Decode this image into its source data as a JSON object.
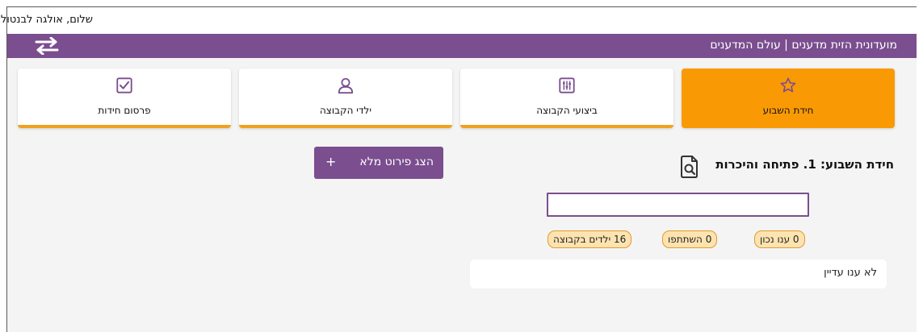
{
  "header": {
    "greeting": "שלום, אולגה לבנטול",
    "title": "מועדונית הזית מדענים | עולם המדענים"
  },
  "tabs": [
    {
      "label": "חידת השבוע",
      "icon": "star-icon",
      "active": true
    },
    {
      "label": "ביצועי הקבוצה",
      "icon": "sliders-icon",
      "active": false
    },
    {
      "label": "ילדי הקבוצה",
      "icon": "user-icon",
      "active": false
    },
    {
      "label": "פרסום חידות",
      "icon": "checkbox-icon",
      "active": false
    }
  ],
  "main": {
    "week_title": "חידת השבוע: 1. פתיחה והיכרות",
    "show_full_label": "הצג פירוט מלא",
    "show_full_plus": "+",
    "answer_value": "",
    "badges": {
      "correct": "0 ענו נכון",
      "participated": "0 השתתפו",
      "kids": "16 ילדים בקבוצה"
    },
    "empty_message": "לא ענו עדיין"
  },
  "colors": {
    "purple": "#7b4e8f",
    "orange": "#f99a05",
    "badge_bg": "#fde3b0",
    "badge_border": "#e29a2b"
  }
}
